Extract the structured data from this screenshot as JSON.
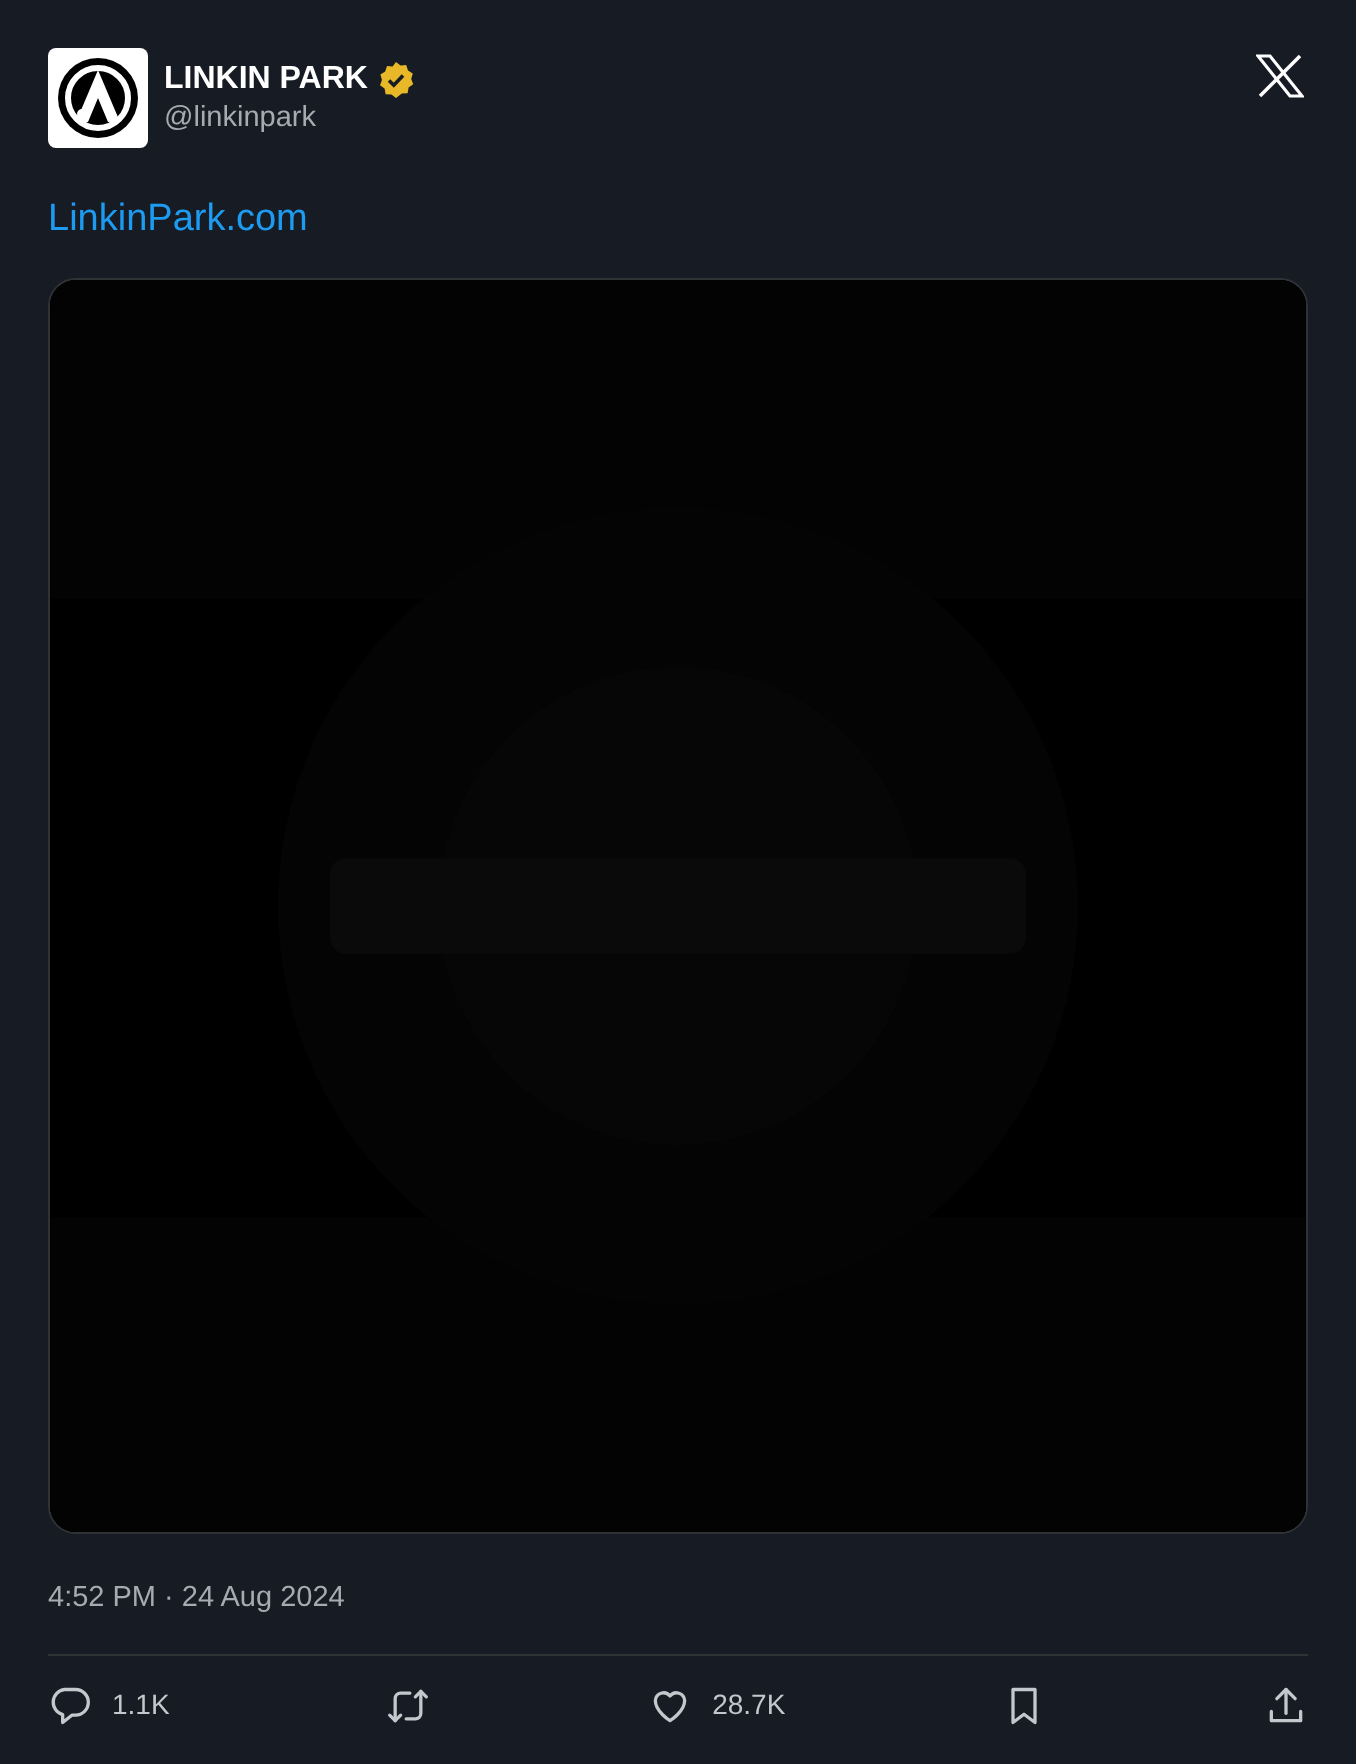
{
  "author": {
    "name": "LINKIN PARK",
    "handle": "@linkinpark",
    "verified": true
  },
  "link": "LinkinPark.com",
  "timestamp": "4:52 PM · 24 Aug 2024",
  "actions": [
    {
      "kind": "reply",
      "count": "1.1K"
    },
    {
      "kind": "repost"
    },
    {
      "kind": "like",
      "count": "28.7K"
    },
    {
      "kind": "bookmark"
    },
    {
      "kind": "share"
    }
  ]
}
